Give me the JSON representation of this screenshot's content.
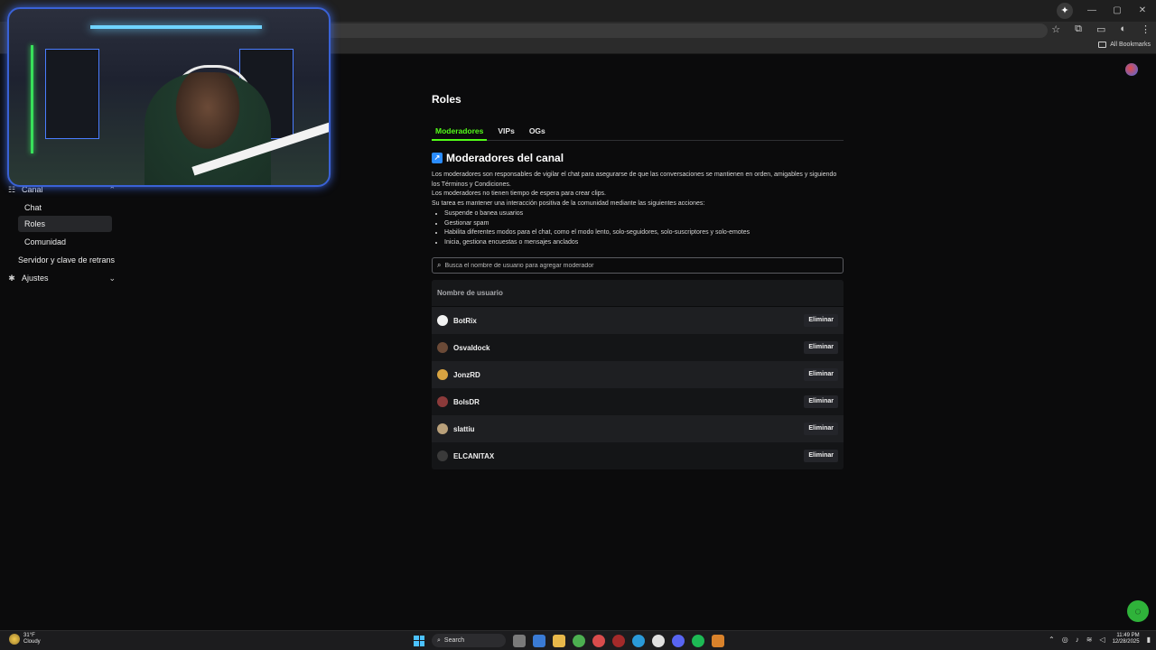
{
  "browser": {
    "bookmarks_label": "All Bookmarks"
  },
  "sidebar": {
    "canal_label": "Canal",
    "items": [
      {
        "label": "Chat"
      },
      {
        "label": "Roles"
      },
      {
        "label": "Comunidad"
      }
    ],
    "servidor_label": "Servidor y clave de retrans",
    "ajustes_label": "Ajustes"
  },
  "main": {
    "title": "Roles",
    "tabs": [
      {
        "label": "Moderadores"
      },
      {
        "label": "VIPs"
      },
      {
        "label": "OGs"
      }
    ],
    "section_title": "Moderadores del canal",
    "desc_lines": [
      "Los moderadores son responsables de vigilar el chat para asegurarse de que las conversaciones se mantienen en orden, amigables y siguiendo los Términos y Condiciones.",
      "Los moderadores no tienen tiempo de espera para crear clips.",
      "Su tarea es mantener una interacción positiva de la comunidad mediante las siguientes acciones:"
    ],
    "bullets": [
      "Suspende o banea usuarios",
      "Gestionar spam",
      "Habilita diferentes modos para el chat, como el modo lento, solo-seguidores, solo-suscriptores y solo-emotes",
      "Inicia, gestiona encuestas o mensajes anclados"
    ],
    "search_placeholder": "Busca el nombre de usuario para agregar moderador",
    "table_header": "Nombre de usuario",
    "delete_label": "Eliminar",
    "moderators": [
      {
        "name": "BotRix",
        "avatar_color": "#f2f2f2"
      },
      {
        "name": "Osvaldock",
        "avatar_color": "#6b4a37"
      },
      {
        "name": "JonzRD",
        "avatar_color": "#d9a441"
      },
      {
        "name": "BolsDR",
        "avatar_color": "#8b3a3a"
      },
      {
        "name": "slattiu",
        "avatar_color": "#b9a07a"
      },
      {
        "name": "ELCANITAX",
        "avatar_color": "#3a3a3a"
      }
    ]
  },
  "taskbar": {
    "weather_temp": "31°F",
    "weather_desc": "Cloudy",
    "search_label": "Search",
    "time": "11:49 PM",
    "date": "12/28/2025"
  },
  "colors": {
    "accent": "#53fc18",
    "cam_border": "#3a62d6"
  }
}
